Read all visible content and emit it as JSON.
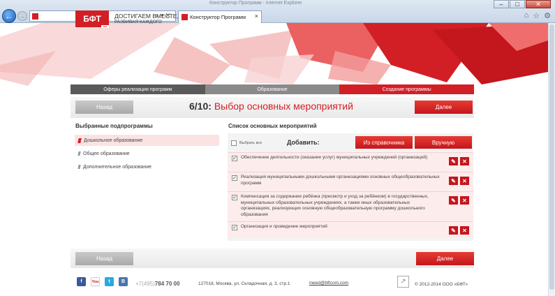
{
  "browser": {
    "window_title": "Конструктор Программ - Internet Explorer",
    "address": "",
    "tab_title": "Конструктор Программ",
    "colors": {
      "favicon": "#d21f26"
    }
  },
  "header": {
    "logo": "БФТ",
    "logo_sub": "BBS",
    "slogan_line1": "ДОСТИГАЕМ ВМЕСТЕ,",
    "slogan_line2": "РАЗВИВАЯ КАЖДОГО"
  },
  "steps": [
    {
      "label": "Оферы реализации программ"
    },
    {
      "label": "Образование"
    },
    {
      "label": "Создание программы"
    }
  ],
  "toolbar": {
    "back_label": "Назад",
    "next_label": "Далее",
    "step_number": "6/10:",
    "step_name": "Выбор основных мероприятий"
  },
  "subprograms": {
    "heading": "Выбранные подпрограммы",
    "items": [
      {
        "label": "Дошкольное образование"
      },
      {
        "label": "Общее образование"
      },
      {
        "label": "Дополнительное образование"
      }
    ]
  },
  "activities": {
    "heading": "Список основных мероприятий",
    "select_all": "Выбрать все",
    "add_label": "Добавить:",
    "from_ref": "Из справочника",
    "manual": "Вручную",
    "items": [
      {
        "text": "Обеспечение деятельности (оказание услуг) муниципальных учреждений (организаций)",
        "checked": "✓"
      },
      {
        "text": "Реализация муниципальными дошкольными организациями основных общеобразовательных программ",
        "checked": "✓"
      },
      {
        "text": "Компенсация за содержание ребёнка (присмотр и уход за ребёнком) в государственных, муниципальных образовательных учреждениях, а также иных образовательных организациях, реализующих основную общеобразовательную программу дошкольного образования",
        "checked": "✓"
      },
      {
        "text": "Организация и проведение мероприятий",
        "checked": "✓"
      }
    ],
    "edit_icon": "✎",
    "delete_icon": "✕"
  },
  "bottom": {
    "back_label": "Назад",
    "next_label": "Далее"
  },
  "footer": {
    "phone_prefix": "+7(495)",
    "phone_number": "784 70 00",
    "address": "127018, Москва, ул. Складочная, д. 3, стр.1",
    "email": "ineed@bftcom.com",
    "copyright": "© 2012-2014 ООО «БФТ»",
    "social": [
      "f",
      "You",
      "t",
      "В"
    ]
  },
  "theme": {
    "accent": "#d21f26",
    "gray": "#8a8a8a"
  }
}
